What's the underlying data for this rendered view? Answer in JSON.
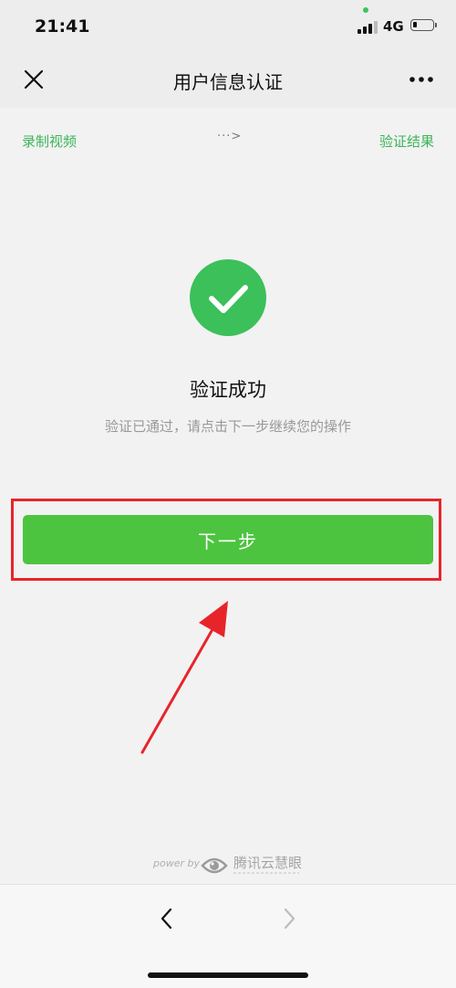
{
  "status_bar": {
    "time": "21:41",
    "network": "4G",
    "icons": [
      "signal-icon",
      "battery-icon"
    ]
  },
  "nav": {
    "title": "用户信息认证",
    "close_icon": "close-icon",
    "more_icon": "more-icon"
  },
  "steps": {
    "left_label": "录制视频",
    "arrow": "···>",
    "right_label": "验证结果",
    "active_color": "#3cb55a"
  },
  "result": {
    "icon": "check-circle-icon",
    "title": "验证成功",
    "description": "验证已通过，请点击下一步继续您的操作",
    "icon_color": "#3cc05a"
  },
  "actions": {
    "next_label": "下一步",
    "button_color": "#4cc43f",
    "highlight_color": "#e8242b"
  },
  "footer": {
    "powered_by": "power by",
    "brand": "腾讯云慧眼",
    "brand_icon": "eye-logo-icon"
  },
  "bottom_nav": {
    "back_icon": "chevron-left-icon",
    "forward_icon": "chevron-right-icon"
  }
}
